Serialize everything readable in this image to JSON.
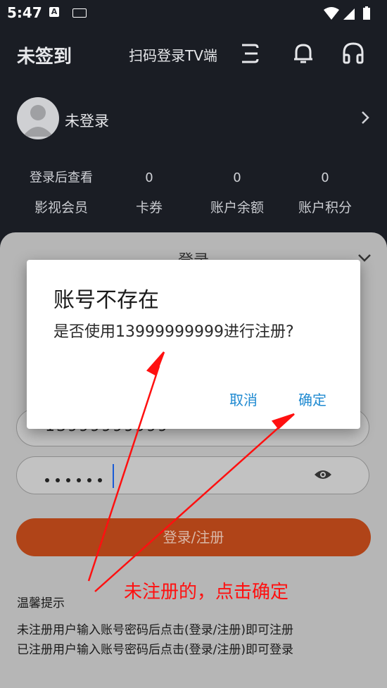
{
  "status_bar": {
    "time": "5:47",
    "a_badge": "A"
  },
  "header": {
    "title": "未签到",
    "scan_label": "扫码登录TV端",
    "icons": [
      "scan-icon",
      "bell-icon",
      "headset-icon"
    ]
  },
  "profile": {
    "name": "未登录"
  },
  "stats": [
    {
      "value": "登录后查看",
      "label": "影视会员"
    },
    {
      "value": "0",
      "label": "卡券"
    },
    {
      "value": "0",
      "label": "账户余额"
    },
    {
      "value": "0",
      "label": "账户积分"
    }
  ],
  "login_sheet": {
    "title": "登录",
    "phone_value": "13999999999",
    "submit_label": "登录/注册",
    "tips_title": "温馨提示",
    "tips": [
      "未注册用户输入账号密码后点击(登录/注册)即可注册",
      "已注册用户输入账号密码后点击(登录/注册)即可登录"
    ]
  },
  "dialog": {
    "title": "账号不存在",
    "message": "是否使用13999999999进行注册?",
    "cancel_label": "取消",
    "confirm_label": "确定"
  },
  "annotation": {
    "text": "未注册的，点击确定",
    "color": "#ff1010"
  },
  "colors": {
    "accent": "#b04418",
    "dialog_button": "#1f8ad1",
    "background": "#1a1d24"
  }
}
